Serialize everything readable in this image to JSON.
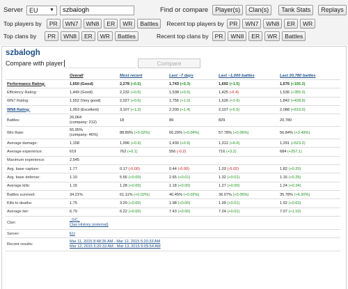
{
  "topbar": {
    "server_label": "Server",
    "server_value": "EU",
    "search_value": "szbalogh",
    "find_label": "Find or compare",
    "players_button": "Player(s)",
    "clans_button": "Clan(s)",
    "tank_stats_button": "Tank Stats",
    "replays_button": "Replays",
    "top_players_label": "Top players by",
    "top_players_buttons": [
      "PR",
      "WN7",
      "WN8",
      "ER",
      "WR",
      "Battles"
    ],
    "recent_top_players_label": "Recent top players by",
    "recent_top_players_buttons": [
      "PR",
      "WN7",
      "WN8",
      "ER",
      "WR"
    ],
    "top_clans_label": "Top clans by",
    "top_clans_buttons": [
      "PR",
      "WN8",
      "ER",
      "WR",
      "Battles"
    ],
    "recent_top_clans_label": "Recent top clans by",
    "recent_top_clans_buttons": [
      "PR",
      "WN8",
      "ER",
      "WR",
      "Battles"
    ]
  },
  "player": {
    "name": "szbalogh",
    "compare_label": "Compare with player",
    "compare_button": "Compare"
  },
  "table": {
    "headers": [
      "",
      "Overall",
      "Most recent",
      "Last ~7 days",
      "Last ~1,000 battles",
      "Last 20,780 battles"
    ],
    "rows": [
      {
        "label": "Performance Rating:",
        "style": "bold",
        "cells": [
          [
            "1,650 (Good)",
            ""
          ],
          [
            "2,278 ",
            "(+0.5)"
          ],
          [
            "1,743 ",
            "(+0.3)"
          ],
          [
            "1,692 ",
            "(+1.5)"
          ],
          [
            "1,676 ",
            "(+155.2)"
          ]
        ],
        "signs": [
          "",
          "pos",
          "pos",
          "pos",
          "pos"
        ]
      },
      {
        "label": "Efficiency Rating:",
        "cells": [
          [
            "1,449 (Good)",
            ""
          ],
          [
            "2,232 ",
            "(+0.6)"
          ],
          [
            "1,538 ",
            "(+0.5)"
          ],
          [
            "1,425 ",
            "(-0.4)"
          ],
          [
            "1,536 ",
            "(+355.0)"
          ]
        ],
        "signs": [
          "",
          "pos",
          "pos",
          "neg",
          "pos"
        ]
      },
      {
        "label": "WN7 Rating:",
        "cells": [
          [
            "1,552 (Very good)",
            ""
          ],
          [
            "2,027 ",
            "(+0.6)"
          ],
          [
            "1,756 ",
            "(+1.0)"
          ],
          [
            "1,626 ",
            "(+2.6)"
          ],
          [
            "1,842 ",
            "(+428.9)"
          ]
        ],
        "signs": [
          "",
          "pos",
          "pos",
          "pos",
          "pos"
        ]
      },
      {
        "label": "WN8 Rating:",
        "style": "link",
        "cells": [
          [
            "1,953 (Excellent)",
            ""
          ],
          [
            "3,107 ",
            "(+1.3)"
          ],
          [
            "2,200 ",
            "(+1.4)"
          ],
          [
            "2,107 ",
            "(+5.5)"
          ],
          [
            "2,088 ",
            "(+619.0)"
          ]
        ],
        "signs": [
          "",
          "pos",
          "pos",
          "pos",
          "pos"
        ]
      },
      {
        "label": "Battles:",
        "tall": true,
        "cells": [
          [
            "26,064",
            ""
          ],
          [
            "18",
            ""
          ],
          [
            "89",
            ""
          ],
          [
            "829",
            ""
          ],
          [
            "20,780",
            ""
          ]
        ],
        "sub": "(company: 212)",
        "signs": [
          "",
          "",
          "",
          "",
          ""
        ]
      },
      {
        "label": "Win Rate:",
        "tall": true,
        "cells": [
          [
            "55.95%",
            ""
          ],
          [
            "88.89% ",
            "(+0.02%)"
          ],
          [
            "66.29% ",
            "(+0.04%)"
          ],
          [
            "57.78% ",
            "(+0.06%)"
          ],
          [
            "56.84% ",
            "(+3.49%)"
          ]
        ],
        "sub": "(company: 46%)",
        "signs": [
          "",
          "pos",
          "pos",
          "pos",
          "pos"
        ]
      },
      {
        "label": "Average damage:",
        "cells": [
          [
            "1,158",
            ""
          ],
          [
            "1,996 ",
            "(+0.9)"
          ],
          [
            "1,430 ",
            "(+0.9)"
          ],
          [
            "1,312 ",
            "(+6.0)"
          ],
          [
            "1,291 ",
            "(+523.2)"
          ]
        ],
        "signs": [
          "",
          "pos",
          "pos",
          "pos",
          "pos"
        ]
      },
      {
        "label": "Average experience:",
        "cells": [
          [
            "619",
            ""
          ],
          [
            "762 ",
            "(+0.1)"
          ],
          [
            "556 ",
            "(-0.2)"
          ],
          [
            "716 ",
            "(+3.2)"
          ],
          [
            "684 ",
            "(+257.1)"
          ]
        ],
        "signs": [
          "",
          "pos",
          "neg",
          "pos",
          "pos"
        ]
      },
      {
        "label": "Maximum experience:",
        "cells": [
          [
            "2,545",
            ""
          ],
          [
            "",
            ""
          ],
          [
            "",
            ""
          ],
          [
            "",
            ""
          ],
          [
            "",
            ""
          ]
        ],
        "signs": [
          "",
          "",
          "",
          "",
          ""
        ]
      },
      {
        "label": "Avg. base capture:",
        "cells": [
          [
            "1.77",
            ""
          ],
          [
            "0.17 ",
            "(-0.00)"
          ],
          [
            "0.44 ",
            "(-0.00)"
          ],
          [
            "1.03 ",
            "(-0.02)"
          ],
          [
            "1.82 ",
            "(+0.20)"
          ]
        ],
        "signs": [
          "",
          "neg",
          "neg",
          "neg",
          "pos"
        ]
      },
      {
        "label": "Avg. base defense:",
        "cells": [
          [
            "1.10",
            ""
          ],
          [
            "5.56 ",
            "(+0.00)"
          ],
          [
            "2.65 ",
            "(+0.01)"
          ],
          [
            "1.32 ",
            "(+0.01)"
          ],
          [
            "1.16 ",
            "(+0.25)"
          ]
        ],
        "signs": [
          "",
          "pos",
          "pos",
          "pos",
          "pos"
        ]
      },
      {
        "label": "Average kills:",
        "cells": [
          [
            "1.15",
            ""
          ],
          [
            "1.28 ",
            "(+0.00)"
          ],
          [
            "1.18 ",
            "(+0.00)"
          ],
          [
            "1.27 ",
            "(+0.00)"
          ],
          [
            "1.24 ",
            "(+0.34)"
          ]
        ],
        "signs": [
          "",
          "pos",
          "pos",
          "pos",
          "pos"
        ]
      },
      {
        "label": "Battles survived:",
        "cells": [
          [
            "34.21%",
            ""
          ],
          [
            "61.11% ",
            "(+0.02%)"
          ],
          [
            "40.45% ",
            "(+0.02%)"
          ],
          [
            "36.07% ",
            "(+0.05%)"
          ],
          [
            "35.78% ",
            "(+6.20%)"
          ]
        ],
        "signs": [
          "",
          "pos",
          "pos",
          "pos",
          "pos"
        ]
      },
      {
        "label": "Kills to deaths:",
        "cells": [
          [
            "1.75",
            ""
          ],
          [
            "3.29 ",
            "(+0.00)"
          ],
          [
            "1.98 ",
            "(+0.00)"
          ],
          [
            "1.99 ",
            "(+0.01)"
          ],
          [
            "1.92 ",
            "(+0.63)"
          ]
        ],
        "signs": [
          "",
          "pos",
          "pos",
          "pos",
          "pos"
        ]
      },
      {
        "label": "Average tier:",
        "cells": [
          [
            "6.79",
            ""
          ],
          [
            "6.22 ",
            "(+0.00)"
          ],
          [
            "7.43 ",
            "(+0.00)"
          ],
          [
            "7.24 ",
            "(+0.01)"
          ],
          [
            "7.07 ",
            "(+1.10)"
          ]
        ],
        "signs": [
          "",
          "pos",
          "pos",
          "pos",
          "pos"
        ]
      }
    ],
    "clan_label": "Clan:",
    "clan_tag": "_GC_",
    "clan_history": "Clan History (external)",
    "server_label": "Server:",
    "server_value": "EU",
    "recent_label": "Recent results:",
    "recent_results": [
      "Mar 11, 2015 8:48:36 AM - Mar 12, 2015 5:20:33 AM",
      "Mar 12, 2015 5:20:33 AM - Mar 13, 2015 9:09:54 AM"
    ]
  }
}
